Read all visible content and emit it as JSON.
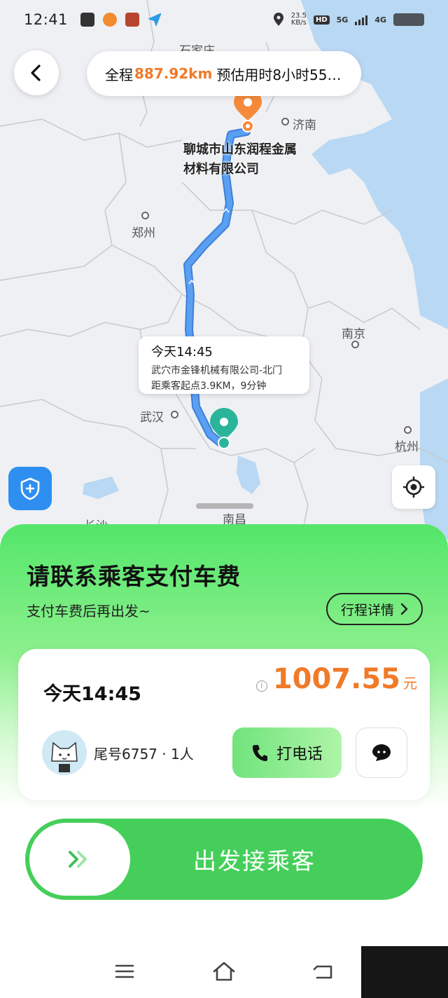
{
  "status_bar": {
    "time": "12:41",
    "net_speed": "23.5",
    "net_unit": "KB/s",
    "hd": "HD",
    "sim": "5G",
    "carrier2": "4G"
  },
  "route": {
    "prefix": "全程",
    "distance": "887.92km",
    "eta": "预估用时8小时55…"
  },
  "map": {
    "cities": {
      "shijiazhuang": "石家庄",
      "jinan": "济南",
      "zhengzhou": "郑州",
      "nanjing": "南京",
      "wuhan": "武汉",
      "hangzhou": "杭州",
      "nanchang": "南昌",
      "changsha": "长沙"
    },
    "destination_line1": "聊城市山东润程金属",
    "destination_line2": "材料有限公司",
    "bubble": {
      "time": "今天14:45",
      "place": "武穴市金锋机械有限公司-北门",
      "distance": "距乘客起点3.9KM，9分钟"
    }
  },
  "sheet": {
    "title": "请联系乘客支付车费",
    "subtitle": "支付车费后再出发~",
    "detail_button": "行程详情",
    "card": {
      "time": "今天14:45",
      "info_icon": "i",
      "price": "1007.55",
      "price_unit": "元",
      "passenger": "尾号6757 · 1人",
      "call_button": "打电话"
    },
    "slider_label": "出发接乘客"
  },
  "colors": {
    "accent_orange": "#f07a28",
    "green": "#45cf5a",
    "route_blue": "#4a8fe8",
    "pin_orange": "#f58b3a",
    "pin_teal": "#2ab59a"
  }
}
